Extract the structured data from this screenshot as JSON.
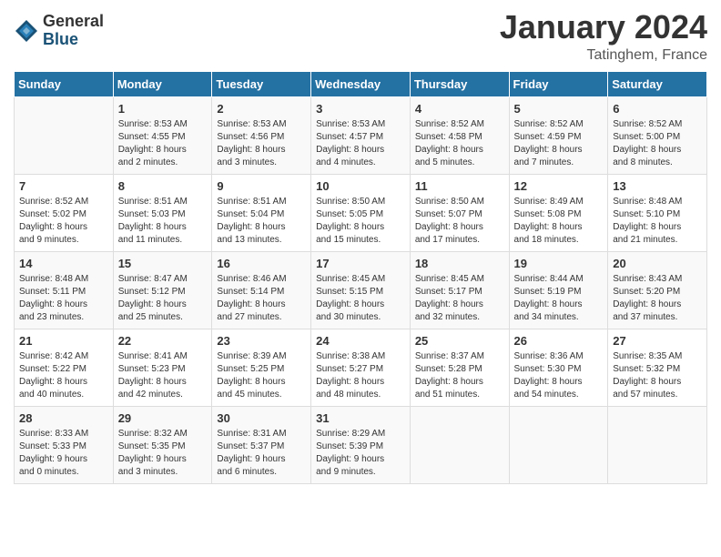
{
  "header": {
    "logo_general": "General",
    "logo_blue": "Blue",
    "title": "January 2024",
    "location": "Tatinghem, France"
  },
  "columns": [
    "Sunday",
    "Monday",
    "Tuesday",
    "Wednesday",
    "Thursday",
    "Friday",
    "Saturday"
  ],
  "weeks": [
    [
      {
        "date": "",
        "info": ""
      },
      {
        "date": "1",
        "info": "Sunrise: 8:53 AM\nSunset: 4:55 PM\nDaylight: 8 hours\nand 2 minutes."
      },
      {
        "date": "2",
        "info": "Sunrise: 8:53 AM\nSunset: 4:56 PM\nDaylight: 8 hours\nand 3 minutes."
      },
      {
        "date": "3",
        "info": "Sunrise: 8:53 AM\nSunset: 4:57 PM\nDaylight: 8 hours\nand 4 minutes."
      },
      {
        "date": "4",
        "info": "Sunrise: 8:52 AM\nSunset: 4:58 PM\nDaylight: 8 hours\nand 5 minutes."
      },
      {
        "date": "5",
        "info": "Sunrise: 8:52 AM\nSunset: 4:59 PM\nDaylight: 8 hours\nand 7 minutes."
      },
      {
        "date": "6",
        "info": "Sunrise: 8:52 AM\nSunset: 5:00 PM\nDaylight: 8 hours\nand 8 minutes."
      }
    ],
    [
      {
        "date": "7",
        "info": "Sunrise: 8:52 AM\nSunset: 5:02 PM\nDaylight: 8 hours\nand 9 minutes."
      },
      {
        "date": "8",
        "info": "Sunrise: 8:51 AM\nSunset: 5:03 PM\nDaylight: 8 hours\nand 11 minutes."
      },
      {
        "date": "9",
        "info": "Sunrise: 8:51 AM\nSunset: 5:04 PM\nDaylight: 8 hours\nand 13 minutes."
      },
      {
        "date": "10",
        "info": "Sunrise: 8:50 AM\nSunset: 5:05 PM\nDaylight: 8 hours\nand 15 minutes."
      },
      {
        "date": "11",
        "info": "Sunrise: 8:50 AM\nSunset: 5:07 PM\nDaylight: 8 hours\nand 17 minutes."
      },
      {
        "date": "12",
        "info": "Sunrise: 8:49 AM\nSunset: 5:08 PM\nDaylight: 8 hours\nand 18 minutes."
      },
      {
        "date": "13",
        "info": "Sunrise: 8:48 AM\nSunset: 5:10 PM\nDaylight: 8 hours\nand 21 minutes."
      }
    ],
    [
      {
        "date": "14",
        "info": "Sunrise: 8:48 AM\nSunset: 5:11 PM\nDaylight: 8 hours\nand 23 minutes."
      },
      {
        "date": "15",
        "info": "Sunrise: 8:47 AM\nSunset: 5:12 PM\nDaylight: 8 hours\nand 25 minutes."
      },
      {
        "date": "16",
        "info": "Sunrise: 8:46 AM\nSunset: 5:14 PM\nDaylight: 8 hours\nand 27 minutes."
      },
      {
        "date": "17",
        "info": "Sunrise: 8:45 AM\nSunset: 5:15 PM\nDaylight: 8 hours\nand 30 minutes."
      },
      {
        "date": "18",
        "info": "Sunrise: 8:45 AM\nSunset: 5:17 PM\nDaylight: 8 hours\nand 32 minutes."
      },
      {
        "date": "19",
        "info": "Sunrise: 8:44 AM\nSunset: 5:19 PM\nDaylight: 8 hours\nand 34 minutes."
      },
      {
        "date": "20",
        "info": "Sunrise: 8:43 AM\nSunset: 5:20 PM\nDaylight: 8 hours\nand 37 minutes."
      }
    ],
    [
      {
        "date": "21",
        "info": "Sunrise: 8:42 AM\nSunset: 5:22 PM\nDaylight: 8 hours\nand 40 minutes."
      },
      {
        "date": "22",
        "info": "Sunrise: 8:41 AM\nSunset: 5:23 PM\nDaylight: 8 hours\nand 42 minutes."
      },
      {
        "date": "23",
        "info": "Sunrise: 8:39 AM\nSunset: 5:25 PM\nDaylight: 8 hours\nand 45 minutes."
      },
      {
        "date": "24",
        "info": "Sunrise: 8:38 AM\nSunset: 5:27 PM\nDaylight: 8 hours\nand 48 minutes."
      },
      {
        "date": "25",
        "info": "Sunrise: 8:37 AM\nSunset: 5:28 PM\nDaylight: 8 hours\nand 51 minutes."
      },
      {
        "date": "26",
        "info": "Sunrise: 8:36 AM\nSunset: 5:30 PM\nDaylight: 8 hours\nand 54 minutes."
      },
      {
        "date": "27",
        "info": "Sunrise: 8:35 AM\nSunset: 5:32 PM\nDaylight: 8 hours\nand 57 minutes."
      }
    ],
    [
      {
        "date": "28",
        "info": "Sunrise: 8:33 AM\nSunset: 5:33 PM\nDaylight: 9 hours\nand 0 minutes."
      },
      {
        "date": "29",
        "info": "Sunrise: 8:32 AM\nSunset: 5:35 PM\nDaylight: 9 hours\nand 3 minutes."
      },
      {
        "date": "30",
        "info": "Sunrise: 8:31 AM\nSunset: 5:37 PM\nDaylight: 9 hours\nand 6 minutes."
      },
      {
        "date": "31",
        "info": "Sunrise: 8:29 AM\nSunset: 5:39 PM\nDaylight: 9 hours\nand 9 minutes."
      },
      {
        "date": "",
        "info": ""
      },
      {
        "date": "",
        "info": ""
      },
      {
        "date": "",
        "info": ""
      }
    ]
  ]
}
